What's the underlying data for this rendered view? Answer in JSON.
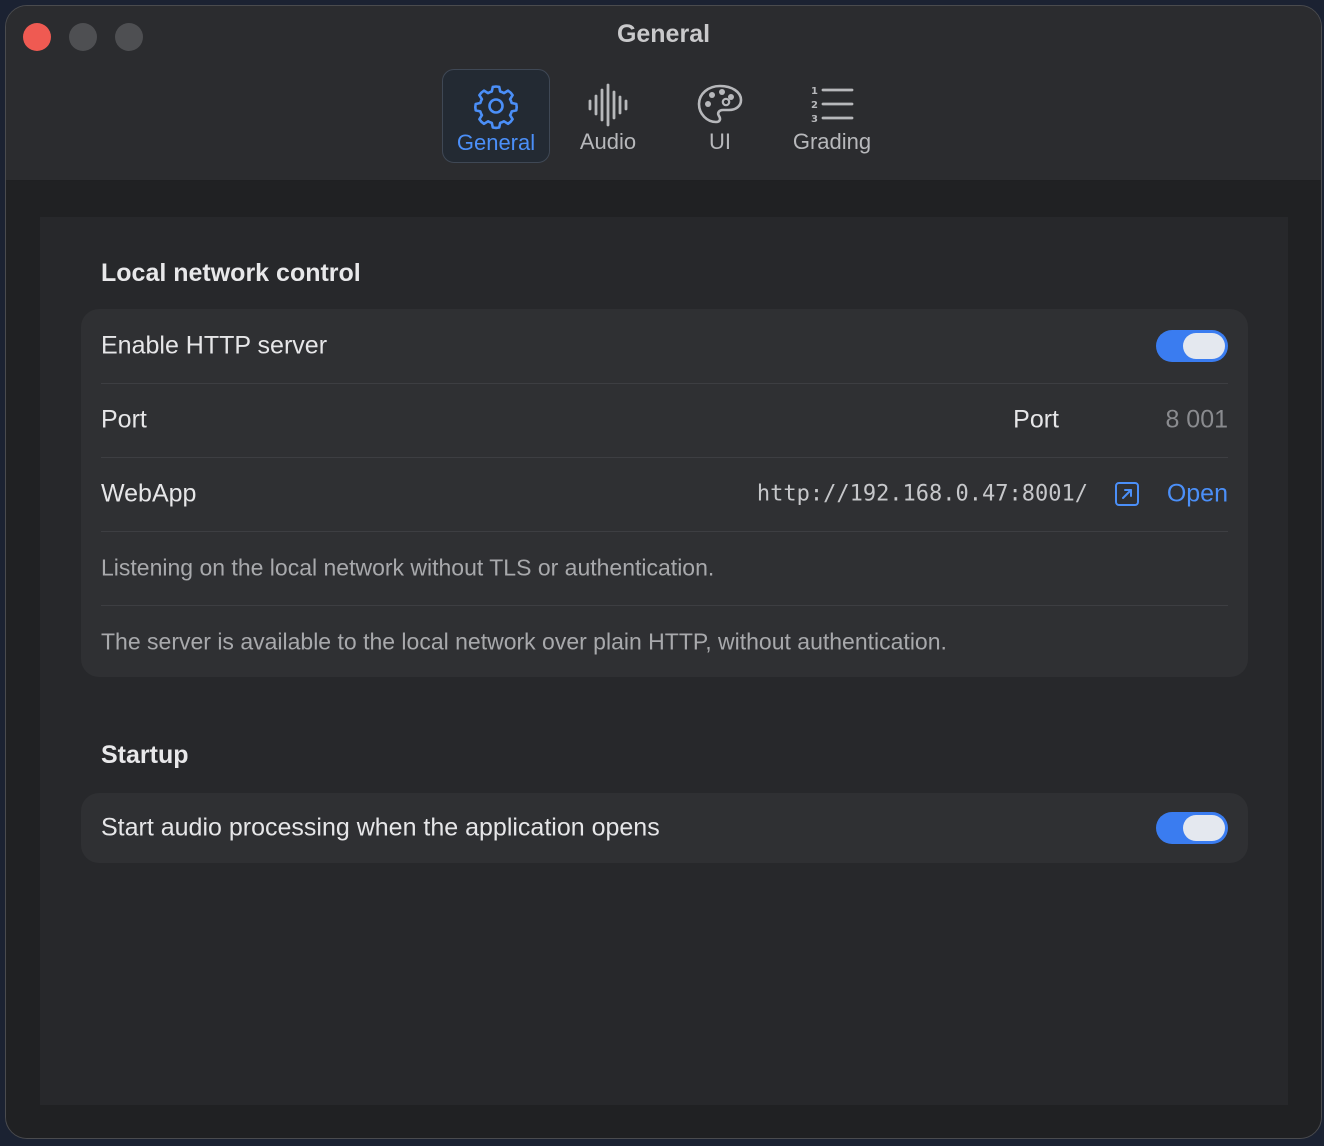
{
  "window": {
    "title": "General"
  },
  "tabs": [
    {
      "label": "General",
      "icon": "gear-icon",
      "active": true
    },
    {
      "label": "Audio",
      "icon": "waveform-icon",
      "active": false
    },
    {
      "label": "UI",
      "icon": "palette-icon",
      "active": false
    },
    {
      "label": "Grading",
      "icon": "numbered-list-icon",
      "active": false
    }
  ],
  "local_network": {
    "title": "Local network control",
    "enable_http_label": "Enable HTTP server",
    "enable_http_on": true,
    "port_row_label": "Port",
    "port_field_label": "Port",
    "port_value": "8 001",
    "webapp_label": "WebApp",
    "webapp_url": "http://192.168.0.47:8001/",
    "open_label": "Open",
    "note_listening": "Listening on the local network without TLS or authentication.",
    "note_available": "The server is available to the local network over plain HTTP, without authentication."
  },
  "startup": {
    "title": "Startup",
    "start_audio_label": "Start audio processing when the application opens",
    "start_audio_on": true
  },
  "colors": {
    "accent": "#3a7cf0",
    "link": "#4b8ff8",
    "close": "#ef5a52"
  }
}
